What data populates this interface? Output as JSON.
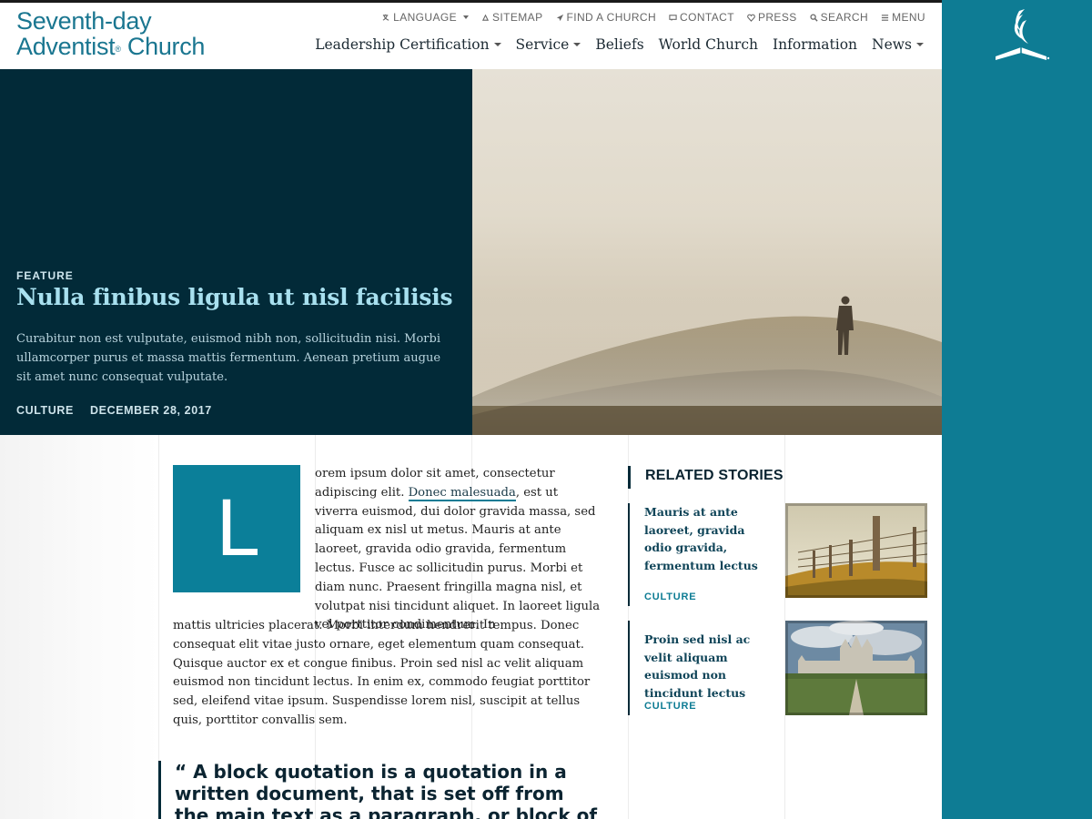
{
  "brand": {
    "line1": "Seventh-day",
    "line2a": "Adventist",
    "reg": "®",
    "line2b": " Church"
  },
  "utility_nav": [
    {
      "icon": "language-icon",
      "label": "LANGUAGE",
      "dropdown": true
    },
    {
      "icon": "sitemap-icon",
      "label": "SITEMAP"
    },
    {
      "icon": "location-icon",
      "label": "FIND A CHURCH"
    },
    {
      "icon": "chat-icon",
      "label": "CONTACT"
    },
    {
      "icon": "press-icon",
      "label": "PRESS"
    },
    {
      "icon": "search-icon",
      "label": "SEARCH"
    },
    {
      "icon": "menu-icon",
      "label": "MENU"
    }
  ],
  "main_nav": [
    {
      "label": "Leadership Certification",
      "dropdown": true
    },
    {
      "label": "Service",
      "dropdown": true
    },
    {
      "label": "Beliefs"
    },
    {
      "label": "World Church"
    },
    {
      "label": "Information"
    },
    {
      "label": "News",
      "dropdown": true
    }
  ],
  "hero": {
    "kicker": "FEATURE",
    "title": "Nulla finibus ligula ut nisl facilisis",
    "deck": "Curabitur non est vulputate, euismod nibh non, sollicitudin nisi. Morbi ullamcorper purus et massa mattis fermentum. Aenean pretium augue sit amet nunc consequat vulputate.",
    "category": "CULTURE",
    "date": "DECEMBER 28, 2017"
  },
  "article": {
    "dropcap": "L",
    "top_before_link": "orem ipsum dolor sit amet, consectetur adipiscing elit. ",
    "link_text": "Donec malesuada",
    "top_after_link": ", est ut viverra euismod, dui dolor gravida massa, sed aliquam ex nisl ut metus. Mauris at ante laoreet, gravida odio gravida, fermentum lectus. Fusce ac sollicitudin purus. Morbi et diam nunc. Praesent fringilla magna nisl, et volutpat nisi tincidunt aliquet. In laoreet ligula vel porttitor condimentum. In",
    "bottom": "mattis ultricies placerat. Morbi interdum hendrerit tempus. Donec consequat elit vitae justo ornare, eget elementum quam consequat. Quisque auctor ex et congue finibus. Proin sed nisl ac velit aliquam euismod non tincidunt lectus. In enim ex, commodo feugiat porttitor sed, eleifend vitae ipsum. Suspendisse lorem nisl, suscipit at tellus quis, porttitor convallis sem.",
    "blockquote": "“ A block quotation is a quotation in a written document, that is set off from the main text as a paragraph, or block of text, and typically"
  },
  "related": {
    "heading": "RELATED STORIES",
    "stories": [
      {
        "title": "Mauris at ante laoreet, gravida odio gravida, fermentum lectus",
        "category": "CULTURE"
      },
      {
        "title": "Proin sed nisl ac velit aliquam euismod non tincidunt lectus",
        "category": "CULTURE"
      }
    ]
  },
  "colors": {
    "teal": "#0e7c94",
    "navy": "#022a38",
    "hero_title": "#a8e0ef"
  }
}
